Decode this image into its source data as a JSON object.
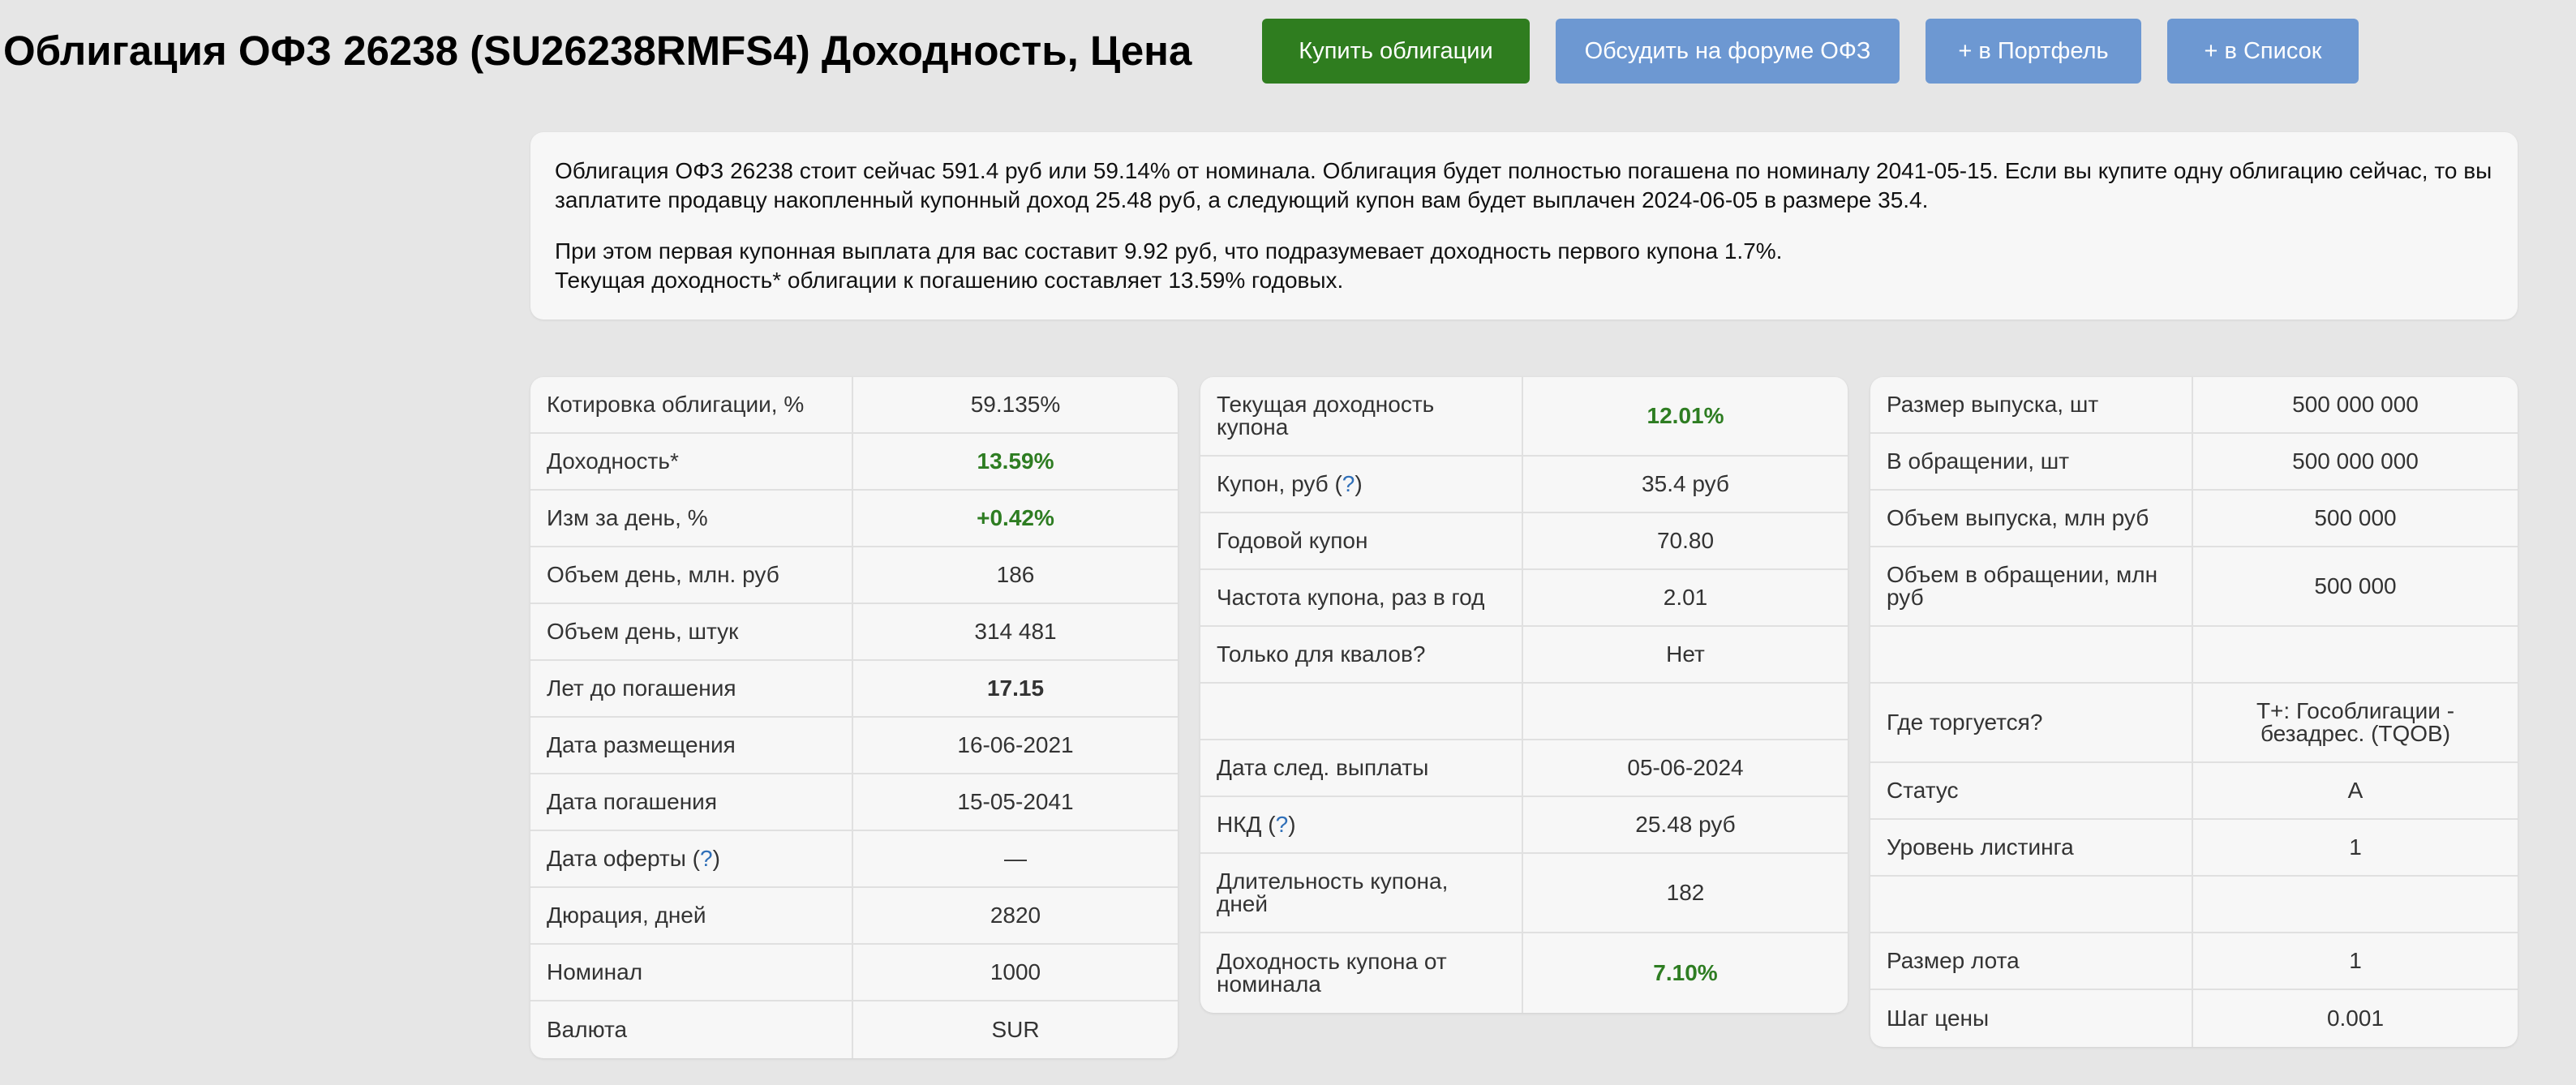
{
  "header": {
    "title": "Облигация ОФЗ 26238 (SU26238RMFS4) Доходность, Цена",
    "buttons": {
      "buy": "Купить облигации",
      "forum": "Обсудить на форуме ОФЗ",
      "portfolio": "+ в Портфель",
      "list": "+ в Список"
    }
  },
  "colors": {
    "accent_green": "#2f7d1f",
    "button_blue": "#6d98d2",
    "value_green": "#2e7d22",
    "help_link": "#2f6fb8"
  },
  "info": {
    "p1": "Облигация ОФЗ 26238 стоит сейчас 591.4 руб или 59.14% от номинала. Облигация будет полностью погашена по номиналу 2041-05-15. Если вы купите одну облигацию сейчас, то вы заплатите продавцу накопленный купонный доход 25.48 руб, а следующий купон вам будет выплачен 2024-06-05 в размере 35.4.",
    "p2a": "При этом первая купонная выплата для вас составит 9.92 руб, что подразумевает доходность первого купона 1.7%.",
    "p2b": "Текущая доходность* облигации к погашению составляет 13.59% годовых."
  },
  "help_mark": "?",
  "table1": [
    {
      "label": "Котировка облигации, %",
      "value": "59.135%"
    },
    {
      "label": "Доходность*",
      "value": "13.59%"
    },
    {
      "label": "Изм за день, %",
      "value": "+0.42%"
    },
    {
      "label": "Объем день, млн. руб",
      "value": "186"
    },
    {
      "label": "Объем день, штук",
      "value": "314 481"
    },
    {
      "label": "Лет до погашения",
      "value": "17.15"
    },
    {
      "label": "Дата размещения",
      "value": "16-06-2021"
    },
    {
      "label": "Дата погашения",
      "value": "15-05-2041"
    },
    {
      "label": "Дата оферты",
      "value": "—"
    },
    {
      "label": "Дюрация, дней",
      "value": "2820"
    },
    {
      "label": "Номинал",
      "value": "1000"
    },
    {
      "label": "Валюта",
      "value": "SUR"
    }
  ],
  "table2": [
    {
      "label": "Текущая доходность купона",
      "value": "12.01%"
    },
    {
      "label": "Купон, руб",
      "value": "35.4 руб"
    },
    {
      "label": "Годовой купон",
      "value": "70.80"
    },
    {
      "label": "Частота купона, раз в год",
      "value": "2.01"
    },
    {
      "label": "Только для квалов?",
      "value": "Нет"
    },
    {
      "label": "",
      "value": ""
    },
    {
      "label": "Дата след. выплаты",
      "value": "05-06-2024"
    },
    {
      "label": "НКД",
      "value": "25.48 руб"
    },
    {
      "label": "Длительность купона, дней",
      "value": "182"
    },
    {
      "label": "Доходность купона от номинала",
      "value": "7.10%"
    }
  ],
  "table3": [
    {
      "label": "Размер выпуска, шт",
      "value": "500 000 000"
    },
    {
      "label": "В обращении, шт",
      "value": "500 000 000"
    },
    {
      "label": "Объем выпуска, млн руб",
      "value": "500 000"
    },
    {
      "label": "Объем в обращении, млн руб",
      "value": "500 000"
    },
    {
      "label": "",
      "value": ""
    },
    {
      "label": "Где торгуется?",
      "value": "T+: Гособлигации - безадрес. (TQOB)"
    },
    {
      "label": "Статус",
      "value": "A"
    },
    {
      "label": "Уровень листинга",
      "value": "1"
    },
    {
      "label": "",
      "value": ""
    },
    {
      "label": "Размер лота",
      "value": "1"
    },
    {
      "label": "Шаг цены",
      "value": "0.001"
    }
  ]
}
